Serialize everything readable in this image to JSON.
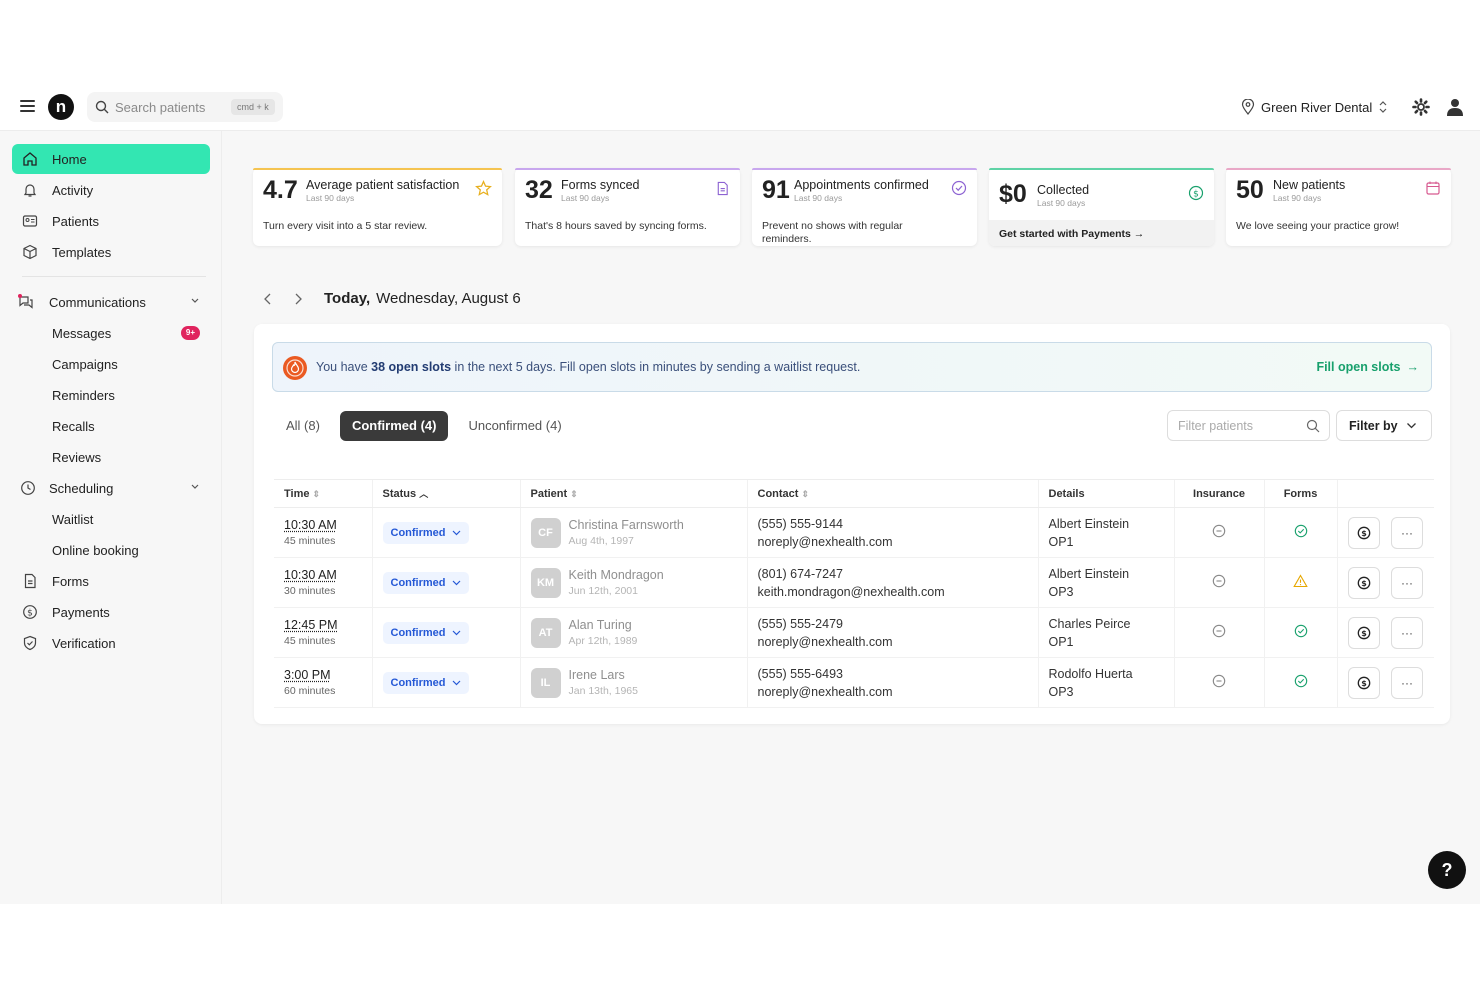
{
  "header": {
    "search_placeholder": "Search patients",
    "search_shortcut": "cmd + k",
    "practice_name": "Green River Dental",
    "logo_letter": "n"
  },
  "sidebar": {
    "items": [
      {
        "label": "Home",
        "icon": "home-icon",
        "active": true
      },
      {
        "label": "Activity",
        "icon": "bell-icon"
      },
      {
        "label": "Patients",
        "icon": "id-card-icon"
      },
      {
        "label": "Templates",
        "icon": "cube-icon"
      },
      {
        "label": "Communications",
        "icon": "chat-icon"
      },
      {
        "label": "Messages",
        "badge": "9+"
      },
      {
        "label": "Campaigns"
      },
      {
        "label": "Reminders"
      },
      {
        "label": "Recalls"
      },
      {
        "label": "Reviews"
      },
      {
        "label": "Scheduling",
        "icon": "clock-icon"
      },
      {
        "label": "Waitlist"
      },
      {
        "label": "Online booking"
      },
      {
        "label": "Forms",
        "icon": "document-icon"
      },
      {
        "label": "Payments",
        "icon": "dollar-icon"
      },
      {
        "label": "Verification",
        "icon": "shield-icon"
      }
    ]
  },
  "stats": [
    {
      "value": "4.7",
      "title": "Average patient satisfaction",
      "period": "Last 90 days",
      "desc": "Turn every visit into a 5 star review.",
      "accent": "#f5c451",
      "icon": "star-icon"
    },
    {
      "value": "32",
      "title": "Forms synced",
      "period": "Last 90 days",
      "desc": "That's 8 hours saved by syncing forms.",
      "accent": "#c8a7ee",
      "icon": "document-icon"
    },
    {
      "value": "91",
      "title": "Appointments confirmed",
      "period": "Last 90 days",
      "desc": "Prevent no shows with regular reminders.",
      "accent": "#c8a7ee",
      "icon": "check-circle-icon"
    },
    {
      "value": "$0",
      "title": "Collected",
      "period": "Last 90 days",
      "desc": "Get started with Payments",
      "accent": "#5fd3a6",
      "icon": "dollar-icon"
    },
    {
      "value": "50",
      "title": "New patients",
      "period": "Last 90 days",
      "desc": "We love seeing your practice grow!",
      "accent": "#e9a8c7",
      "icon": "calendar-icon"
    }
  ],
  "date_header": {
    "prefix": "Today,",
    "date": "Wednesday, August 6"
  },
  "banner": {
    "pre": "You have",
    "highlight": "38 open slots",
    "post": "in the next 5 days. Fill open slots in minutes by sending a waitlist request.",
    "action": "Fill open slots"
  },
  "tabs": [
    {
      "label": "All (8)"
    },
    {
      "label": "Confirmed (4)",
      "active": true
    },
    {
      "label": "Unconfirmed (4)"
    }
  ],
  "filter": {
    "placeholder": "Filter patients",
    "button": "Filter by"
  },
  "table": {
    "headers": [
      "Time",
      "Status",
      "Patient",
      "Contact",
      "Details",
      "Insurance",
      "Forms"
    ],
    "rows": [
      {
        "time": "10:30 AM",
        "duration": "45 minutes",
        "status": "Confirmed",
        "initials": "CF",
        "name": "Christina Farnsworth",
        "dob": "Aug 4th, 1997",
        "phone": "(555) 555-9144",
        "email": "noreply@nexhealth.com",
        "provider": "Albert Einstein",
        "room": "OP1",
        "forms": "check"
      },
      {
        "time": "10:30 AM",
        "duration": "30 minutes",
        "status": "Confirmed",
        "initials": "KM",
        "name": "Keith Mondragon",
        "dob": "Jun 12th, 2001",
        "phone": "(801) 674-7247",
        "email": "keith.mondragon@nexhealth.com",
        "provider": "Albert Einstein",
        "room": "OP3",
        "forms": "warning"
      },
      {
        "time": "12:45 PM",
        "duration": "45 minutes",
        "status": "Confirmed",
        "initials": "AT",
        "name": "Alan Turing",
        "dob": "Apr 12th, 1989",
        "phone": "(555) 555-2479",
        "email": "noreply@nexhealth.com",
        "provider": "Charles Peirce",
        "room": "OP1",
        "forms": "check"
      },
      {
        "time": "3:00 PM",
        "duration": "60 minutes",
        "status": "Confirmed",
        "initials": "IL",
        "name": "Irene Lars",
        "dob": "Jan 13th, 1965",
        "phone": "(555) 555-6493",
        "email": "noreply@nexhealth.com",
        "provider": "Rodolfo Huerta",
        "room": "OP3",
        "forms": "check"
      }
    ],
    "more_label": "···"
  },
  "help_label": "?",
  "colors": {
    "accent": "#33e6b2",
    "confirmed": "#2458d6",
    "success": "#18a06c",
    "warning": "#e6a700",
    "badge": "#e0245e"
  }
}
